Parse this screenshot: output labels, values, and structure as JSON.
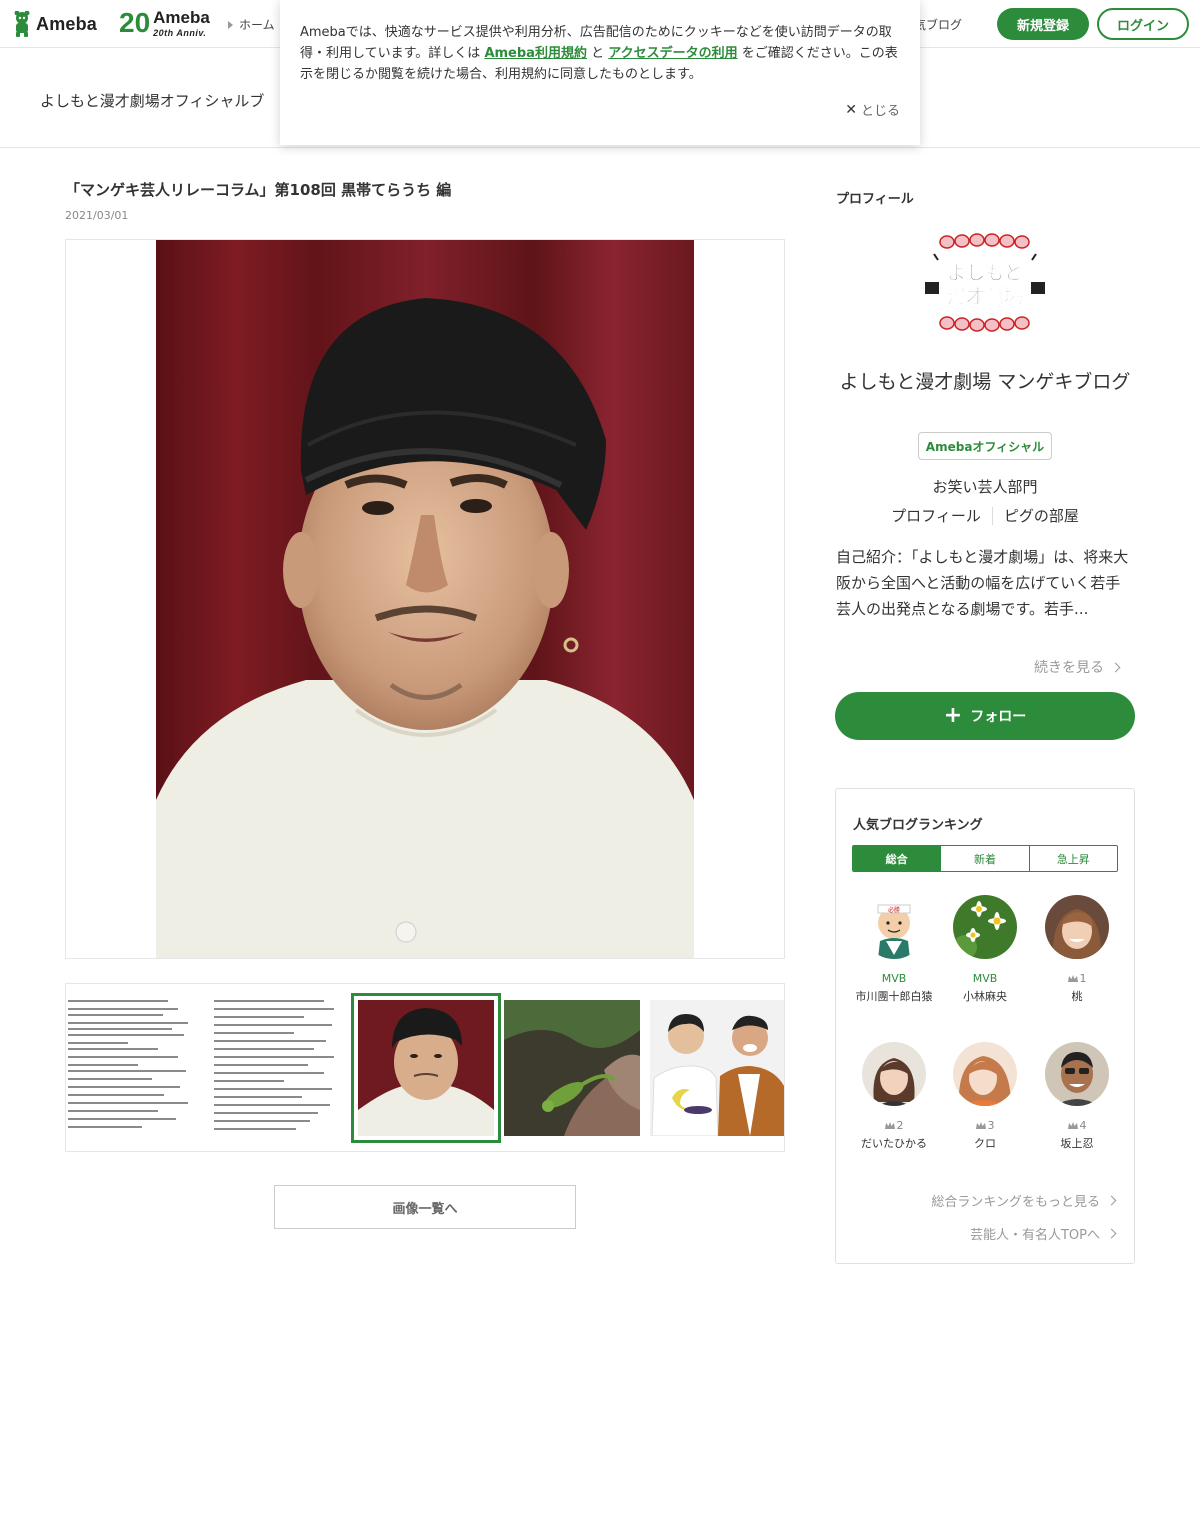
{
  "header": {
    "logo_text": "Ameba",
    "anniv_number": "20",
    "anniv_brand": "Ameba",
    "anniv_sub": "20th Anniv.",
    "home_label": "ホーム",
    "blog_label": "気ブログ",
    "register_label": "新規登録",
    "login_label": "ログイン"
  },
  "blog": {
    "title": "よしもと漫才劇場オフィシャルブ"
  },
  "cookie": {
    "text_before": "Amebaでは、快適なサービス提供や利用分析、広告配信のためにクッキーなどを使い訪問データの取得・利用しています。詳しくは ",
    "link1": "Ameba利用規約",
    "text_mid": " と ",
    "link2": "アクセスデータの利用",
    "text_after": " をご確認ください。この表示を閉じるか閲覧を続けた場合、利用規約に同意したものとします。",
    "close_label": "とじる"
  },
  "post": {
    "title": "「マンゲキ芸人リレーコラム」第108回 黒帯てらうち 編",
    "date": "2021/03/01",
    "images_button": "画像一覧へ"
  },
  "sidebar": {
    "heading": "プロフィール",
    "logo_alt": "よしもと漫才劇場",
    "name": "よしもと漫才劇場 マンゲキブログ",
    "official_badge": "Amebaオフィシャル",
    "category": "お笑い芸人部門",
    "link_profile": "プロフィール",
    "link_room": "ピグの部屋",
    "intro": "自己紹介：「よしもと漫才劇場」は、将来大阪から全国へと活動の幅を広げていく若手芸人の出発点となる劇場です。若手...",
    "more_label": "続きを見る",
    "follow_label": "フォロー"
  },
  "ranking": {
    "title": "人気ブログランキング",
    "tabs": [
      "総合",
      "新着",
      "急上昇"
    ],
    "items": [
      {
        "badge": "MVB",
        "name": "市川團十郎白猿"
      },
      {
        "badge": "MVB",
        "name": "小林麻央"
      },
      {
        "badge": "1",
        "name": "桃"
      },
      {
        "badge": "2",
        "name": "だいたひかる"
      },
      {
        "badge": "3",
        "name": "クロ"
      },
      {
        "badge": "4",
        "name": "坂上忍"
      }
    ],
    "more_label": "総合ランキングをもっと見る",
    "top_label": "芸能人・有名人TOPへ"
  },
  "colors": {
    "accent": "#2d8c3c",
    "text": "#333333",
    "muted": "#999999"
  }
}
